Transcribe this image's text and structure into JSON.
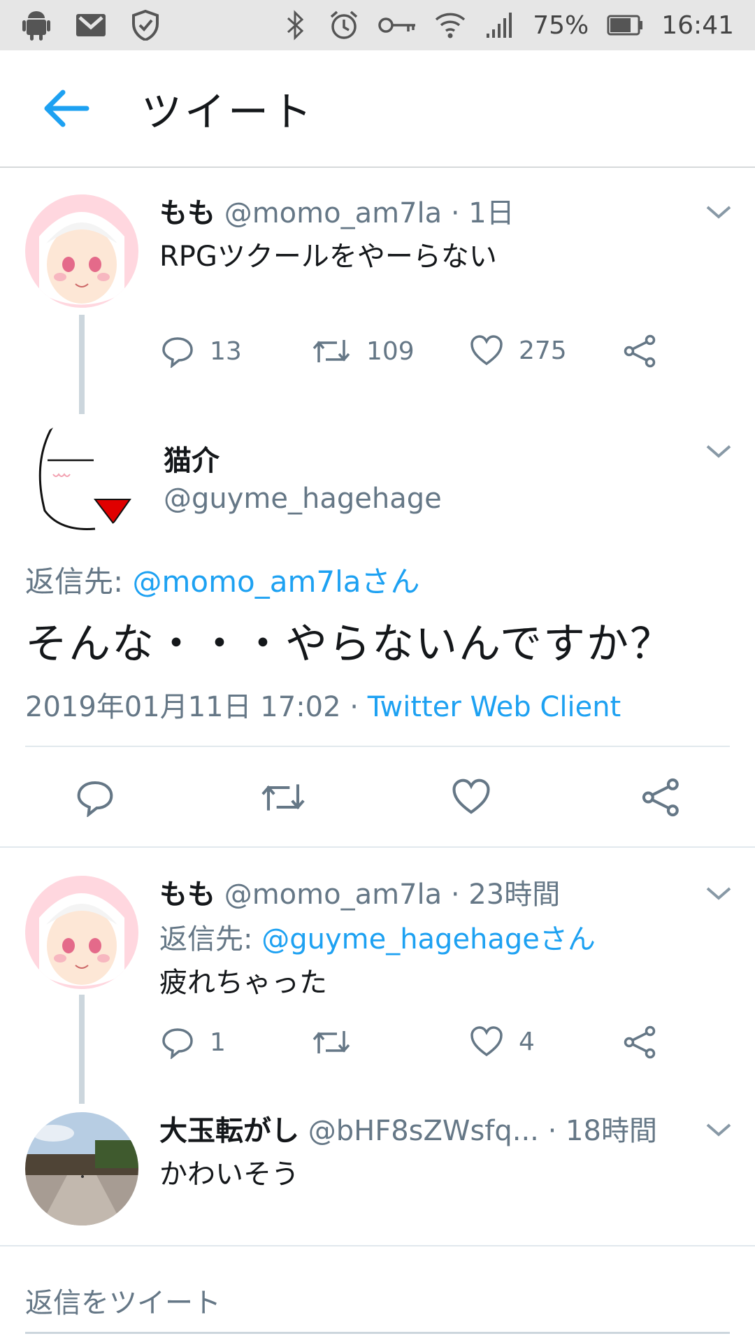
{
  "status_bar": {
    "battery_percent": "75%",
    "time": "16:41",
    "left_icons": [
      "android-icon",
      "gmail-icon",
      "shield-icon"
    ],
    "right_icons": [
      "bluetooth-icon",
      "alarm-icon",
      "vpn-key-icon",
      "wifi-icon",
      "signal-icon",
      "battery-icon"
    ]
  },
  "header": {
    "title": "ツイート"
  },
  "tweet1": {
    "name": "もも",
    "handle": "@momo_am7la",
    "time": "· 1日",
    "text": "RPGツクールをやーらない",
    "replies": "13",
    "retweets": "109",
    "likes": "275"
  },
  "main_tweet": {
    "name": "猫介",
    "handle": "@guyme_hagehage",
    "reply_prefix": "返信先: ",
    "reply_to": "@momo_am7laさん",
    "text": "そんな・・・やらないんですか？",
    "date": "2019年01月11日 17:02 · ",
    "client": "Twitter Web Client"
  },
  "reply1": {
    "name": "もも",
    "handle": "@momo_am7la",
    "time": "· 23時間",
    "reply_prefix": "返信先: ",
    "reply_to": "@guyme_hagehageさん",
    "text": "疲れちゃった",
    "replies": "1",
    "retweets": "",
    "likes": "4"
  },
  "reply2": {
    "name": "大玉転がし",
    "handle": "@bHF8sZWsfq...",
    "time": "· 18時間",
    "text": "かわいそう"
  },
  "compose": {
    "placeholder": "返信をツイート"
  },
  "colors": {
    "accent": "#1da1f2",
    "muted": "#657786",
    "text": "#14171a"
  }
}
